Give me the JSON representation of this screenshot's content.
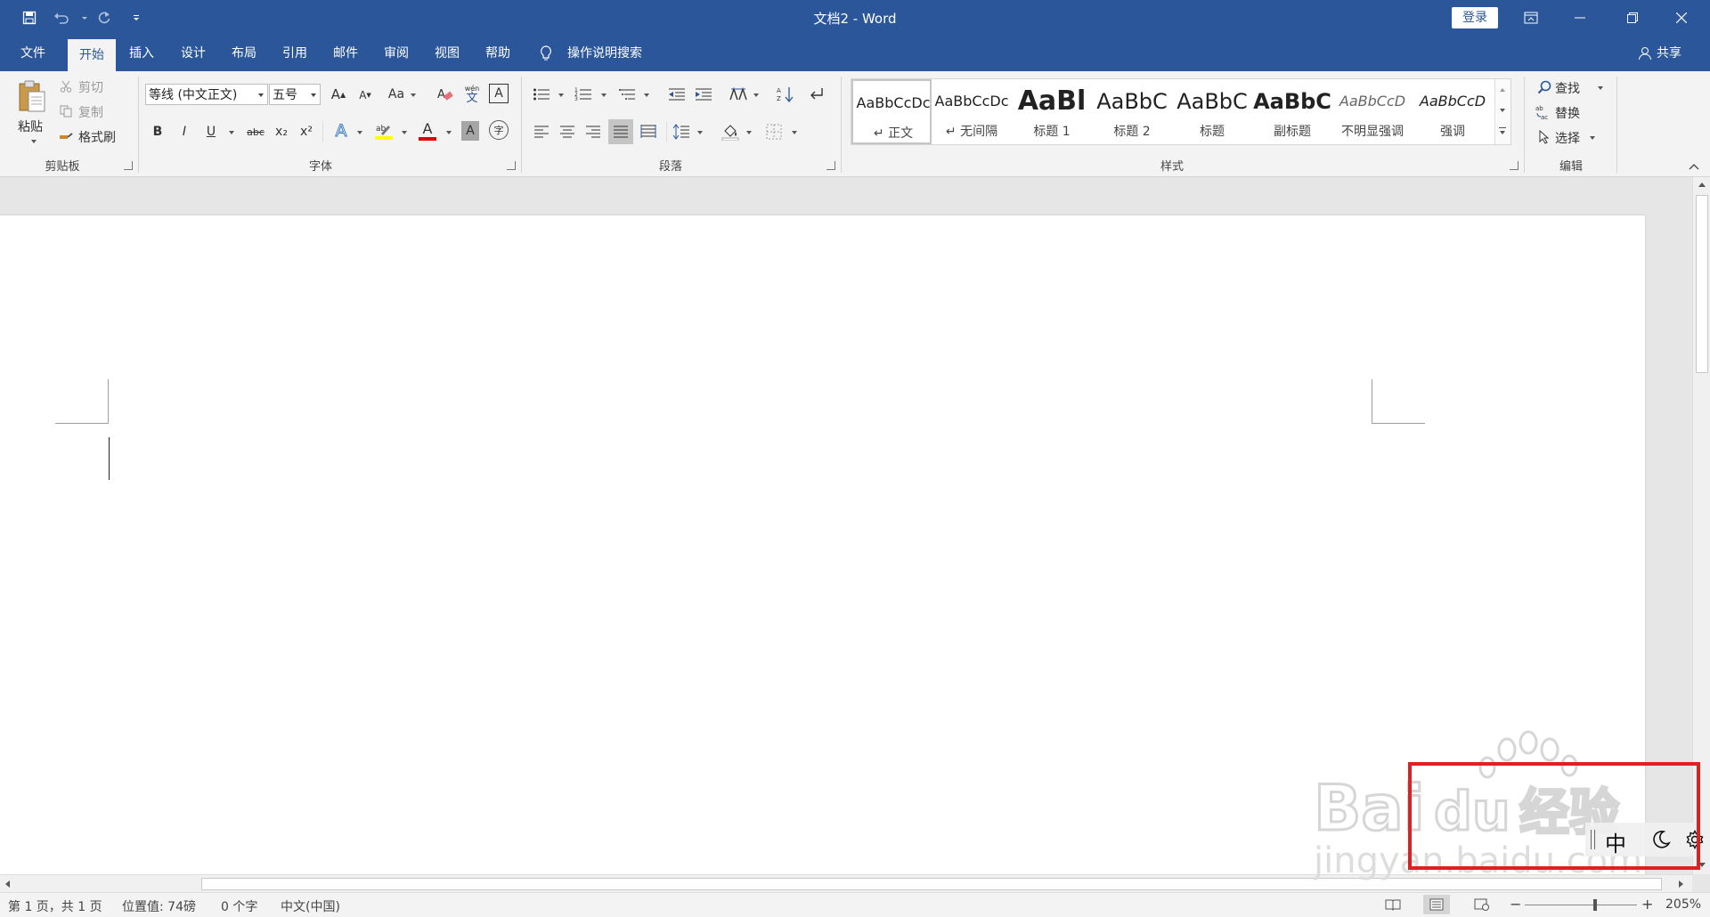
{
  "title_bar": {
    "document_title": "文档2 - Word",
    "login_label": "登录",
    "quick_access_icons": [
      "save-icon",
      "undo-icon",
      "redo-icon",
      "customize-qat-icon"
    ],
    "window_icons": [
      "ribbon-display-options-icon",
      "minimize-icon",
      "restore-icon",
      "close-icon"
    ]
  },
  "tabs": [
    {
      "label": "文件"
    },
    {
      "label": "开始",
      "active": true
    },
    {
      "label": "插入"
    },
    {
      "label": "设计"
    },
    {
      "label": "布局"
    },
    {
      "label": "引用"
    },
    {
      "label": "邮件"
    },
    {
      "label": "审阅"
    },
    {
      "label": "视图"
    },
    {
      "label": "帮助"
    }
  ],
  "tell_me": "操作说明搜索",
  "share_label": "共享",
  "ribbon": {
    "clipboard": {
      "group_label": "剪贴板",
      "paste_label": "粘贴",
      "cut_label": "剪切",
      "copy_label": "复制",
      "format_painter_label": "格式刷"
    },
    "font": {
      "group_label": "字体",
      "font_name": "等线 (中文正文)",
      "font_size": "五号",
      "change_case": "Aa",
      "bold": "B",
      "italic": "I",
      "underline": "U",
      "strikethrough": "abc",
      "subscript": "x₂",
      "superscript": "x²",
      "grow_font": "A",
      "shrink_font": "A",
      "phonetic_top": "wén",
      "phonetic_bottom": "文",
      "char_border": "A",
      "text_effects": "A",
      "font_color": "A",
      "char_shading": "A",
      "enclose_char": "字"
    },
    "paragraph": {
      "group_label": "段落"
    },
    "styles": {
      "group_label": "样式",
      "items": [
        {
          "sample": "AaBbCcDc",
          "name": "正文",
          "selected": true
        },
        {
          "sample": "AaBbCcDc",
          "name": "无间隔"
        },
        {
          "sample": "AaBl",
          "name": "标题 1"
        },
        {
          "sample": "AaBbC",
          "name": "标题 2"
        },
        {
          "sample": "AaBbC",
          "name": "标题"
        },
        {
          "sample": "AaBbC",
          "name": "副标题"
        },
        {
          "sample": "AaBbCcD",
          "name": "不明显强调"
        },
        {
          "sample": "AaBbCcD",
          "name": "强调"
        }
      ]
    },
    "editing": {
      "group_label": "编辑",
      "find_label": "查找",
      "replace_label": "替换",
      "select_label": "选择"
    }
  },
  "status_bar": {
    "page": "第 1 页，共 1 页",
    "position": "位置值: 74磅",
    "word_count": "0 个字",
    "language": "中文(中国)",
    "zoom": "205%",
    "zoom_minus": "−",
    "zoom_plus": "+"
  },
  "ime": {
    "mode": "中",
    "icons": [
      "moon-icon",
      "gear-icon"
    ]
  },
  "watermark": {
    "logo_text": "Baidu经验",
    "url": "jingyan.baidu.com"
  },
  "colors": {
    "title_bar": "#2b579a",
    "ribbon": "#f3f3f3",
    "highlight_box": "#e02020",
    "font_color_bar": "#e00000",
    "highlight_color_bar": "#ffff00"
  }
}
